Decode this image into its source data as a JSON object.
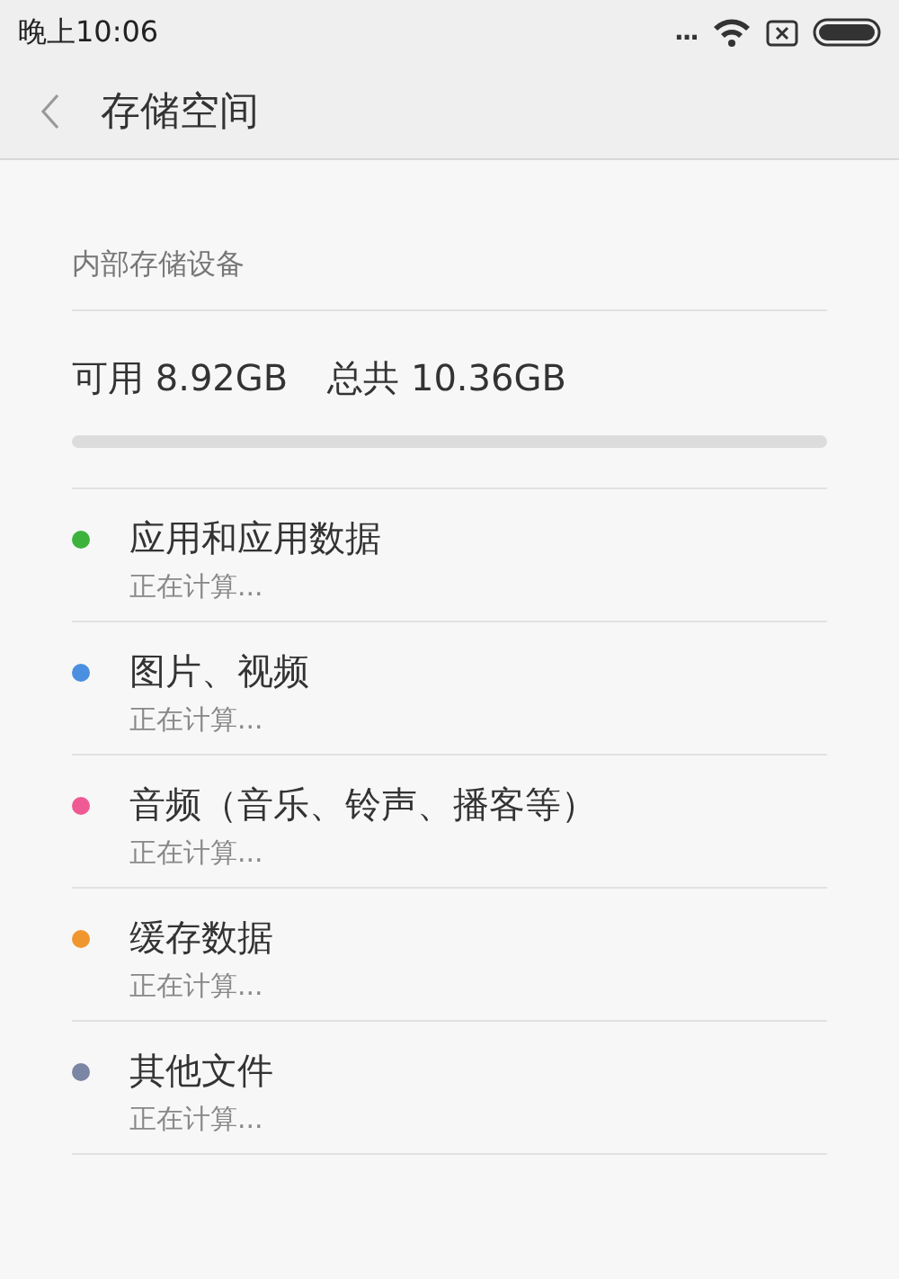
{
  "status_bar": {
    "time": "晚上10:06",
    "more": "..."
  },
  "header": {
    "title": "存储空间"
  },
  "section": {
    "title": "内部存储设备"
  },
  "summary": {
    "available": "可用 8.92GB",
    "total": "总共 10.36GB",
    "level": 0
  },
  "categories": [
    {
      "name": "应用和应用数据",
      "detail": "正在计算...",
      "color": "#3db33d"
    },
    {
      "name": "图片、视频",
      "detail": "正在计算...",
      "color": "#4a8fe0"
    },
    {
      "name": "音频（音乐、铃声、播客等）",
      "detail": "正在计算...",
      "color": "#ef5a95"
    },
    {
      "name": "缓存数据",
      "detail": "正在计算...",
      "color": "#f0962e"
    },
    {
      "name": "其他文件",
      "detail": "正在计算...",
      "color": "#7a86a3"
    }
  ]
}
